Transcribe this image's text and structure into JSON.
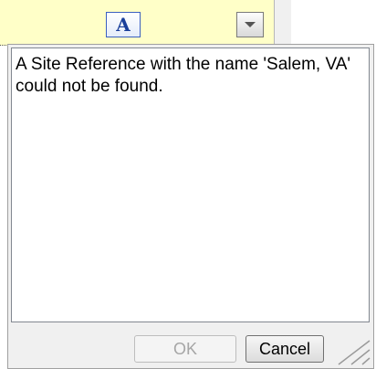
{
  "header": {
    "font_icon_glyph": "A",
    "font_icon": "font-format-icon",
    "dropdown_icon": "chevron-down-icon"
  },
  "dialog": {
    "message": "A Site Reference with the name 'Salem, VA' could not be found.",
    "ok_label": "OK",
    "ok_enabled": false,
    "cancel_label": "Cancel",
    "resize_icon": "resize-grip-icon"
  },
  "colors": {
    "header_bg": "#ffffc8",
    "font_icon_color": "#1a3f9a",
    "panel_bg": "#f0f0f0"
  }
}
